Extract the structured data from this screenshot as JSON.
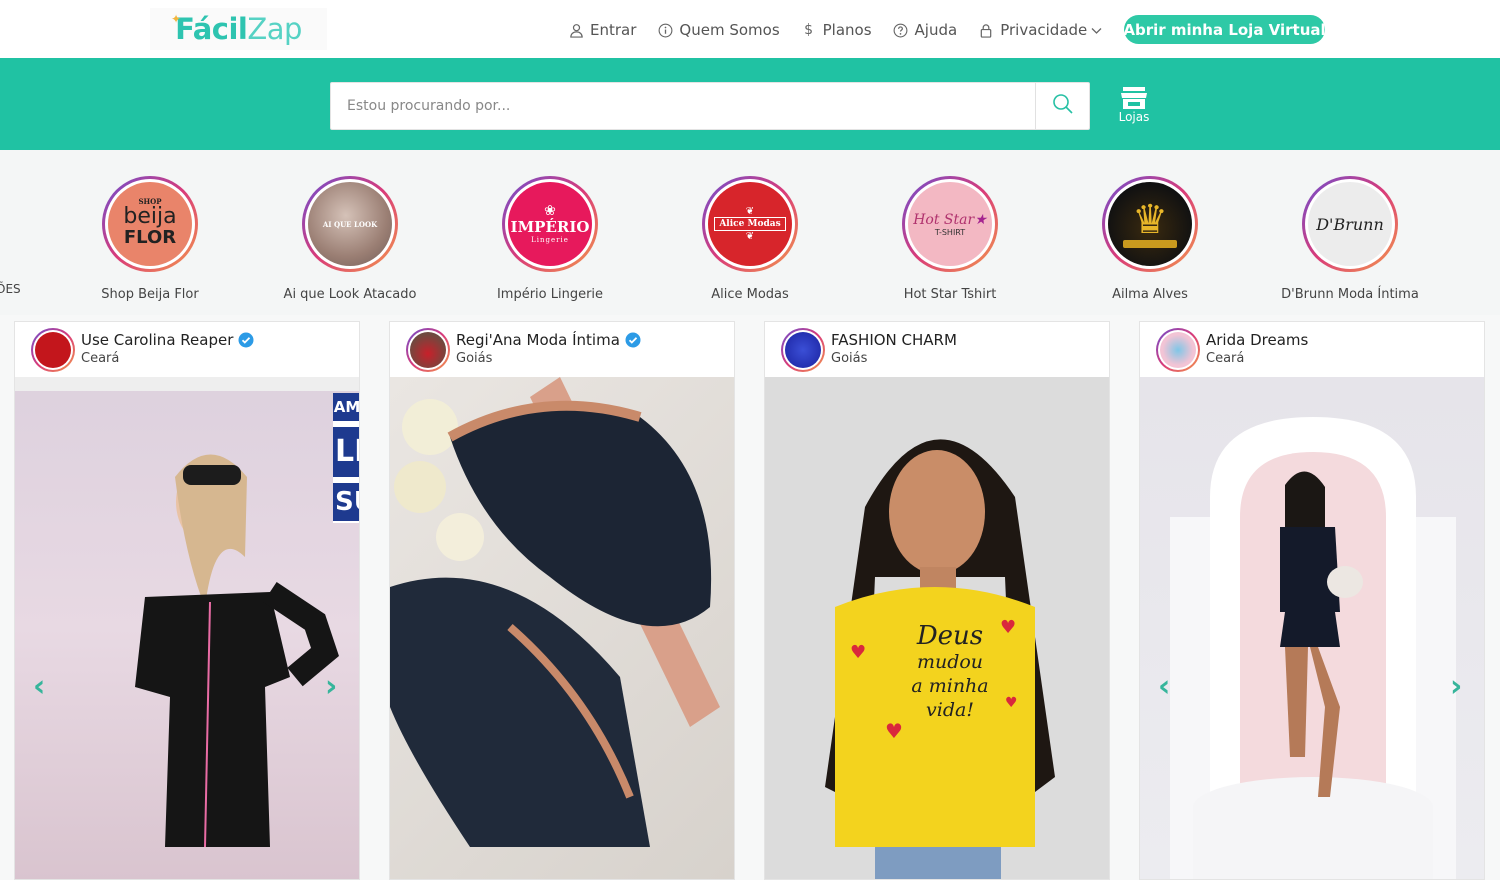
{
  "logo": {
    "part1": "Fácil",
    "part2": "Zap"
  },
  "nav": [
    {
      "label": "Entrar",
      "icon": "user-icon"
    },
    {
      "label": "Quem Somos",
      "icon": "info-icon"
    },
    {
      "label": "Planos",
      "icon": "dollar-icon"
    },
    {
      "label": "Ajuda",
      "icon": "help-icon"
    },
    {
      "label": "Privacidade",
      "icon": "lock-icon"
    }
  ],
  "cta_label": "Abrir minha Loja Virtual",
  "search": {
    "placeholder": "Estou procurando por..."
  },
  "stores_label": "Lojas",
  "story_cut_label": "ÕES",
  "stories": [
    {
      "name": "Shop Beija Flor",
      "avatar_text_top": "SHOP",
      "avatar_text_mid": "beija",
      "avatar_text_bottom": "FLOR"
    },
    {
      "name": "Ai que Look Atacado",
      "avatar_text": "AI QUE LOOK"
    },
    {
      "name": "Império Lingerie",
      "avatar_text": "IMPÉRIO",
      "avatar_sub": "Lingerie"
    },
    {
      "name": "Alice Modas",
      "avatar_text": "Alice Modas"
    },
    {
      "name": "Hot Star Tshirt",
      "avatar_text": "Hot Star",
      "avatar_sub": "T-SHIRT"
    },
    {
      "name": "Ailma Alves",
      "avatar_text": ""
    },
    {
      "name": "D'Brunn Moda Íntima",
      "avatar_text": "D'Brunn"
    }
  ],
  "cards": [
    {
      "name": "Use Carolina Reaper",
      "location": "Ceará",
      "verified": true,
      "banner_text": [
        "AM",
        "LI",
        "SU"
      ]
    },
    {
      "name": "Regi'Ana Moda Íntima",
      "location": "Goiás",
      "verified": true
    },
    {
      "name": "FASHION CHARM",
      "location": "Goiás",
      "verified": false,
      "shirt_text": [
        "Deus",
        "mudou",
        "a minha",
        "vida!"
      ]
    },
    {
      "name": "Arida Dreams",
      "location": "Ceará",
      "verified": false
    }
  ],
  "colors": {
    "brand": "#20c2a3",
    "cta": "#2ec9a6",
    "arrow": "#36b59b",
    "verified": "#2c9be6"
  }
}
